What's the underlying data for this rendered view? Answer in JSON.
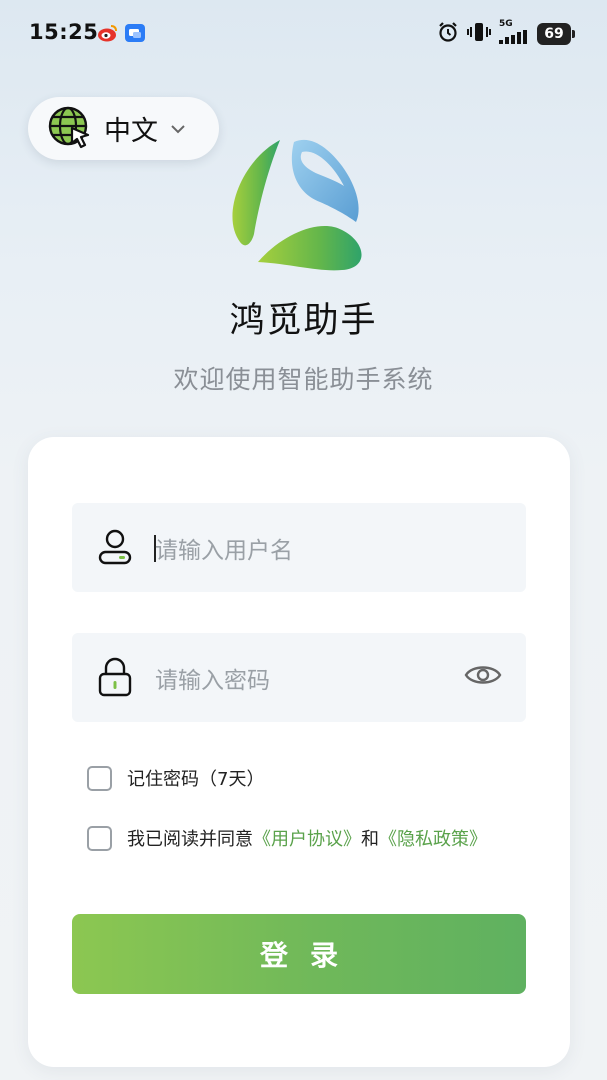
{
  "status_bar": {
    "time": "15:25",
    "network_label": "5G",
    "battery_level": "69",
    "icons": [
      "weibo-icon",
      "chat-app-icon",
      "alarm-icon",
      "vibrate-icon",
      "signal-icon",
      "battery-icon"
    ]
  },
  "language": {
    "label": "中文",
    "icon": "globe-cursor-icon",
    "chevron": "chevron-down-icon"
  },
  "app": {
    "title": "鸿觅助手",
    "subtitle": "欢迎使用智能助手系统"
  },
  "form": {
    "username_placeholder": "请输入用户名",
    "password_placeholder": "请输入密码",
    "remember_label": "记住密码（7天）",
    "agree_prefix": "我已阅读并同意",
    "user_agreement": "《用户协议》",
    "and_text": "和",
    "privacy_policy": "《隐私政策》",
    "login_label": "登录"
  },
  "colors": {
    "accent_green": "#6fb85a",
    "link_green": "#5aa24b",
    "logo_blue": "#7ab6e0"
  }
}
